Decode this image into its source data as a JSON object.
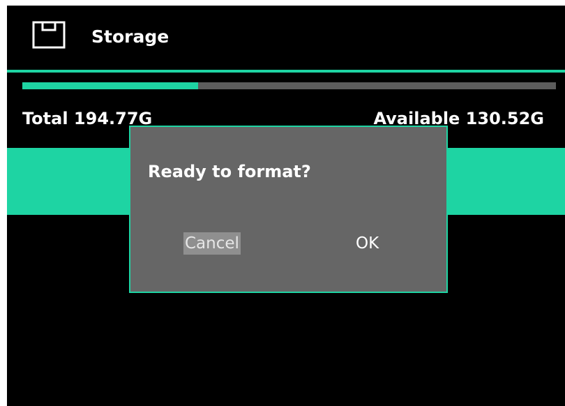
{
  "header": {
    "title": "Storage",
    "icon": "storage-icon"
  },
  "storage": {
    "used_fraction": 0.33,
    "total_label": "Total 194.77G",
    "available_label": "Available 130.52G"
  },
  "dialog": {
    "title": "Ready to format?",
    "cancel_label": "Cancel",
    "ok_label": "OK"
  },
  "colors": {
    "accent": "#1ed4a3",
    "background": "#000000",
    "dialog_bg": "#666666",
    "track": "#5c5c5c"
  }
}
